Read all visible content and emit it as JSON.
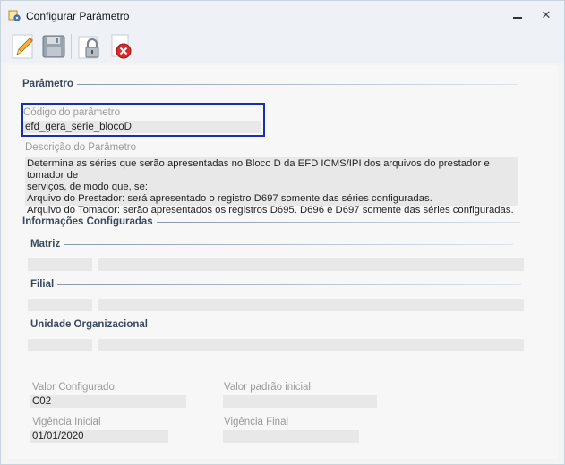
{
  "window": {
    "title": "Configurar Parâmetro",
    "close_glyph": "✕"
  },
  "toolbar": {
    "buttons": [
      {
        "name": "edit-button",
        "icon": "pencil-icon"
      },
      {
        "name": "save-button",
        "icon": "floppy-disk-icon"
      },
      {
        "name": "lock-button",
        "icon": "padlock-icon"
      },
      {
        "name": "delete-button",
        "icon": "document-delete-icon"
      }
    ]
  },
  "parametro": {
    "section_title": "Parâmetro",
    "codigo_label": "Código do parâmetro",
    "codigo_value": "efd_gera_serie_blocoD",
    "descricao_label": "Descrição do Parâmetro",
    "descricao_lines": [
      "Determina as séries que serão apresentadas no Bloco D da EFD ICMS/IPI dos arquivos do prestador e tomador de",
      "serviços, de modo que, se:",
      "Arquivo do Prestador: será apresentado o registro D697 somente das séries configuradas.",
      "Arquivo do Tomador: serão apresentados os registros D695. D696 e D697 somente das séries configuradas."
    ]
  },
  "informacoes": {
    "section_title": "Informações Configuradas",
    "matriz_title": "Matriz",
    "filial_title": "Filial",
    "unidade_title": "Unidade Organizacional"
  },
  "valores": {
    "valor_configurado_label": "Valor Configurado",
    "valor_configurado_value": "C02",
    "valor_padrao_label": "Valor padrão inicial",
    "valor_padrao_value": "",
    "vigencia_inicial_label": "Vigência Inicial",
    "vigencia_inicial_value": "01/01/2020",
    "vigencia_final_label": "Vigência Final",
    "vigencia_final_value": ""
  }
}
